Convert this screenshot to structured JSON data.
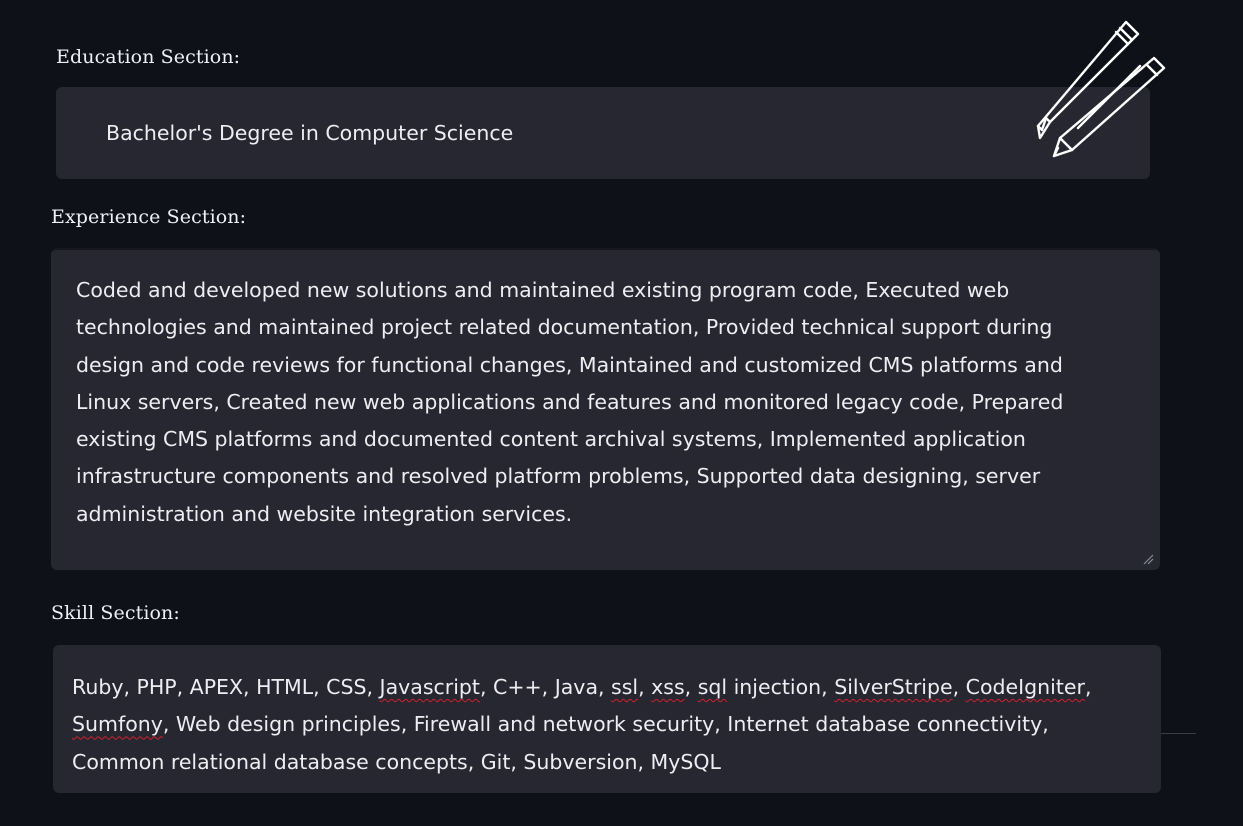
{
  "education": {
    "label": "Education Section:",
    "value": "Bachelor's Degree in Computer Science"
  },
  "experience": {
    "label": "Experience Section:",
    "value": "Coded and developed new solutions and maintained existing program code, Executed web technologies and maintained project related documentation, Provided technical support during design and code reviews for functional changes, Maintained and customized CMS platforms and Linux servers, Created new web applications and features and monitored legacy code, Prepared existing CMS platforms and documented content archival systems, Implemented application infrastructure components and resolved platform problems, Supported data designing, server administration and website integration services."
  },
  "skills": {
    "label": "Skill Section:",
    "segments": [
      {
        "text": "Ruby, PHP, APEX, HTML, CSS, ",
        "misspelled": false
      },
      {
        "text": "Javascript",
        "misspelled": true
      },
      {
        "text": ", C++, Java, ",
        "misspelled": false
      },
      {
        "text": "ssl",
        "misspelled": true
      },
      {
        "text": ", ",
        "misspelled": false
      },
      {
        "text": "xss",
        "misspelled": true
      },
      {
        "text": ", ",
        "misspelled": false
      },
      {
        "text": "sql",
        "misspelled": true
      },
      {
        "text": " injection, ",
        "misspelled": false
      },
      {
        "text": "SilverStripe",
        "misspelled": true
      },
      {
        "text": ", ",
        "misspelled": false
      },
      {
        "text": "CodeIgniter",
        "misspelled": true
      },
      {
        "text": ", ",
        "misspelled": false
      },
      {
        "text": "Sumfony",
        "misspelled": true
      },
      {
        "text": ", Web design principles, Firewall and network security, Internet database connectivity, Common relational database concepts, Git, Subversion, MySQL",
        "misspelled": false
      }
    ]
  },
  "icons": {
    "edit_icon": "pens-icon",
    "resize_icon": "resize-handle-icon"
  },
  "colors": {
    "background": "#0e1117",
    "field_background": "#262730",
    "text": "#eceef2",
    "spellcheck_underline": "#d0202e"
  }
}
